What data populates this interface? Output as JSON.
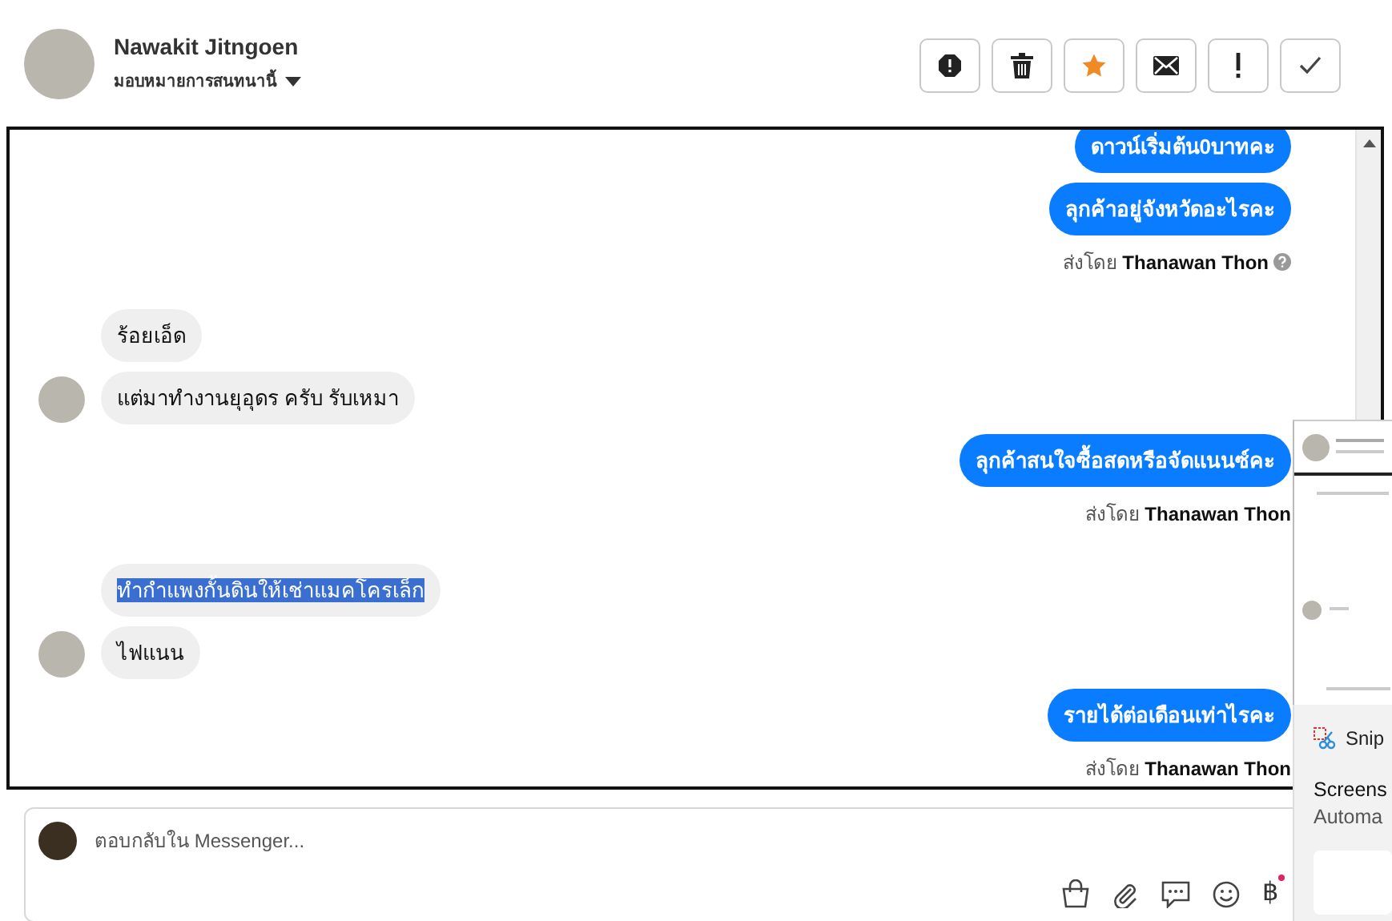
{
  "header": {
    "name": "Nawakit Jitngoen",
    "assign_label": "มอบหมายการสนทนานี้",
    "starred": true
  },
  "messages": [
    {
      "kind": "outgoing",
      "text": "ดาวน์เริ่มต้น0บาทคะ",
      "highlighted": false
    },
    {
      "kind": "outgoing",
      "text": "ลุกค้าอยู่จังหวัดอะไรคะ",
      "highlighted": false
    },
    {
      "kind": "sent_by",
      "text": "ส่งโดย **Thanawan Thon**",
      "info_icon": true
    },
    {
      "kind": "incoming",
      "text": "ร้อยเอ็ด",
      "avatar": false,
      "highlighted": false
    },
    {
      "kind": "incoming",
      "text": "แต่มาทำงานยุอุดร ครับ รับเหมา",
      "avatar": true,
      "highlighted": false
    },
    {
      "kind": "outgoing",
      "text": "ลุกค้าสนใจซื้อสดหรือจัดแนนซ์คะ",
      "highlighted": false
    },
    {
      "kind": "sent_by",
      "text": "ส่งโดย **Thanawan Thon**",
      "info_icon": false
    },
    {
      "kind": "incoming",
      "text": "ทำกำแพงกั้นดินให้เช่าแมคโครเล็ก",
      "avatar": false,
      "highlighted": true
    },
    {
      "kind": "incoming",
      "text": "ไฟแนน",
      "avatar": true,
      "highlighted": false
    },
    {
      "kind": "outgoing",
      "text": "รายได้ต่อเดือนเท่าไรคะ",
      "highlighted": false
    },
    {
      "kind": "sent_by",
      "text": "ส่งโดย **Thanawan Thon**",
      "info_icon": false
    }
  ],
  "composer": {
    "placeholder": "ตอบกลับใน Messenger...",
    "currency_icon": "฿",
    "currency_badge": true
  },
  "snip_notification": {
    "app": "Snip",
    "title": "Screens",
    "subtitle": "Automa"
  }
}
